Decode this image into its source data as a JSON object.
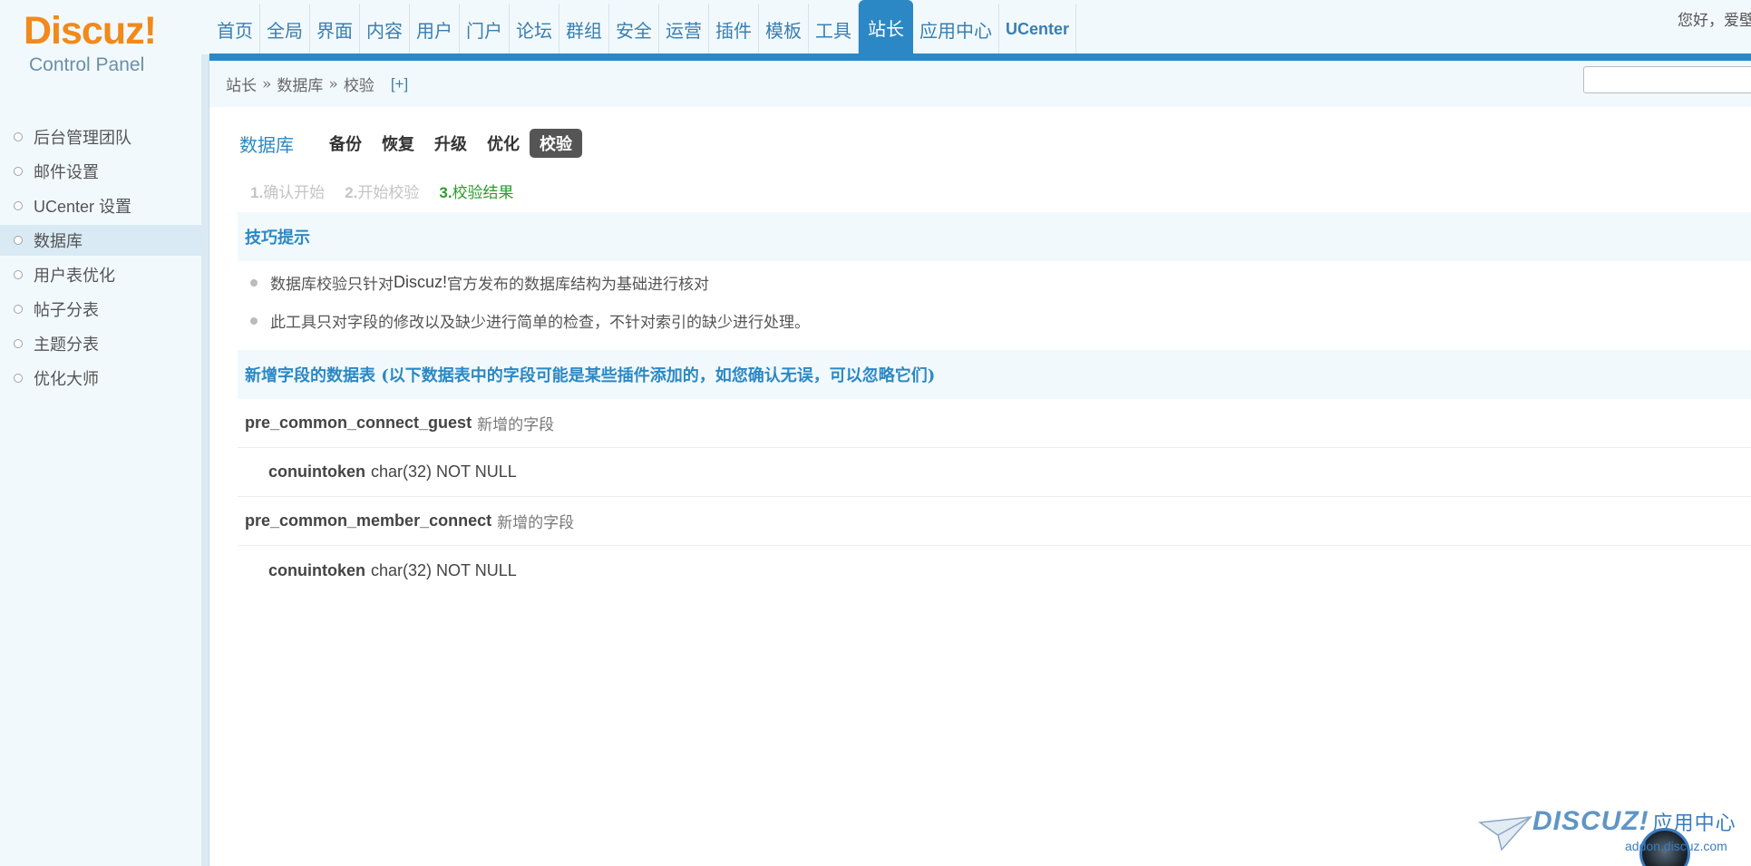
{
  "logo": {
    "main": "Discuz",
    "bang": "!",
    "sub": "Control Panel"
  },
  "greeting": "您好，爱壁",
  "topnav": [
    {
      "label": "首页"
    },
    {
      "label": "全局"
    },
    {
      "label": "界面"
    },
    {
      "label": "内容"
    },
    {
      "label": "用户"
    },
    {
      "label": "门户"
    },
    {
      "label": "论坛"
    },
    {
      "label": "群组"
    },
    {
      "label": "安全"
    },
    {
      "label": "运营"
    },
    {
      "label": "插件"
    },
    {
      "label": "模板"
    },
    {
      "label": "工具"
    },
    {
      "label": "站长"
    },
    {
      "label": "应用中心"
    },
    {
      "label": "UCenter"
    }
  ],
  "active_nav": "站长",
  "breadcrumb": {
    "item1": "站长",
    "sep": "»",
    "item2": "数据库",
    "item3": "校验",
    "plus": "[+]"
  },
  "search": {
    "value": ""
  },
  "sidebar": {
    "items": [
      {
        "label": "后台管理团队"
      },
      {
        "label": "邮件设置"
      },
      {
        "label": "UCenter 设置"
      },
      {
        "label": "数据库"
      },
      {
        "label": "用户表优化"
      },
      {
        "label": "帖子分表"
      },
      {
        "label": "主题分表"
      },
      {
        "label": "优化大师"
      }
    ],
    "active": "数据库"
  },
  "subnav": {
    "title": "数据库",
    "tabs": [
      {
        "label": "备份"
      },
      {
        "label": "恢复"
      },
      {
        "label": "升级"
      },
      {
        "label": "优化"
      },
      {
        "label": "校验"
      }
    ],
    "current": "校验"
  },
  "steps": [
    {
      "num": "1.",
      "label": "确认开始"
    },
    {
      "num": "2.",
      "label": "开始校验"
    },
    {
      "num": "3.",
      "label": "校验结果"
    }
  ],
  "tips": {
    "title": "技巧提示",
    "line1_pre": "数据库校验只针对 ",
    "line1_brand": "Discuz!",
    "line1_post": " 官方发布的数据库结构为基础进行核对",
    "line2": "此工具只对字段的修改以及缺少进行简单的检查，不针对索引的缺少进行处理。"
  },
  "fields_heading": "新增字段的数据表 (以下数据表中的字段可能是某些插件添加的，如您确认无误，可以忽略它们)",
  "tables": [
    {
      "name": "pre_common_connect_guest",
      "note": "新增的字段",
      "field": "conuintoken",
      "type": "char(32) NOT NULL"
    },
    {
      "name": "pre_common_member_connect",
      "note": "新增的字段",
      "field": "conuintoken",
      "type": "char(32) NOT NULL"
    }
  ],
  "watermark": {
    "brand": "DISCUZ!",
    "cn": "应用中心",
    "url": "addon.discuz.com"
  },
  "colors": {
    "accent": "#2b88c4",
    "brand_orange": "#f18a1b",
    "step_done": "#2e9a2e"
  }
}
